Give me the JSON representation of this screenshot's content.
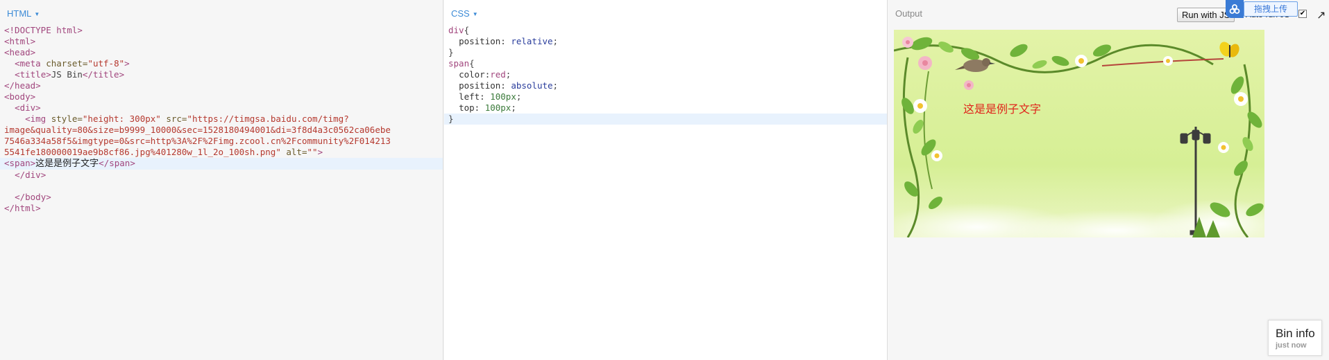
{
  "panels": {
    "html": {
      "label": "HTML"
    },
    "css": {
      "label": "CSS"
    },
    "output": {
      "label": "Output"
    }
  },
  "html_code": {
    "l1": "<!DOCTYPE html>",
    "l2": "<html>",
    "l3": "<head>",
    "l4_tag_open": "<meta",
    "l4_attr": " charset=",
    "l4_val": "\"utf-8\"",
    "l4_close": ">",
    "l5_open": "<title>",
    "l5_text": "JS Bin",
    "l5_close": "</title>",
    "l6": "</head>",
    "l7": "<body>",
    "l8": "<div>",
    "l9_tag": "<img",
    "l9_attr1": " style=",
    "l9_val1": "\"height: 300px\"",
    "l9_attr2": " src=",
    "l9_val2a": "\"https://timgsa.baidu.com/timg?",
    "l10": "image&quality=80&size=b9999_10000&sec=1528180494001&di=3f8d4a3c0562ca06ebe",
    "l11": "7546a334a58f5&imgtype=0&src=http%3A%2F%2Fimg.zcool.cn%2Fcommunity%2F014213",
    "l12_val": "5541fe180000019ae9b8cf86.jpg%401280w_1l_2o_100sh.png\"",
    "l12_attr": " alt=",
    "l12_val2": "\"\"",
    "l12_close": ">",
    "l13_open": "<span>",
    "l13_text": "这是是例子文字",
    "l13_close": "</span>",
    "l14": "</div>",
    "l15": "",
    "l16": "</body>",
    "l17": "</html>"
  },
  "css_code": {
    "l1_sel": "div",
    "l1_brace": "{",
    "l2_prop": "position: ",
    "l2_val": "relative",
    "l3": "}",
    "l4_sel": "span",
    "l4_brace": "{",
    "l5_prop": "color:",
    "l5_val": "red",
    "l6_prop": "position: ",
    "l6_val": "absolute",
    "l7_prop": "left: ",
    "l7_val": "100px",
    "l8_prop": "top: ",
    "l8_val": "100px",
    "l9": "}"
  },
  "toolbar": {
    "run_button": "Run with JS",
    "autorun_label": "Auto-run JS",
    "upload_text": "拖拽上传"
  },
  "output": {
    "span_text": "这是是例子文字"
  },
  "bin_info": {
    "title": "Bin info",
    "subtitle": "just now"
  },
  "colors": {
    "accent": "#3b8ad6",
    "output_text": "#e0241b"
  }
}
